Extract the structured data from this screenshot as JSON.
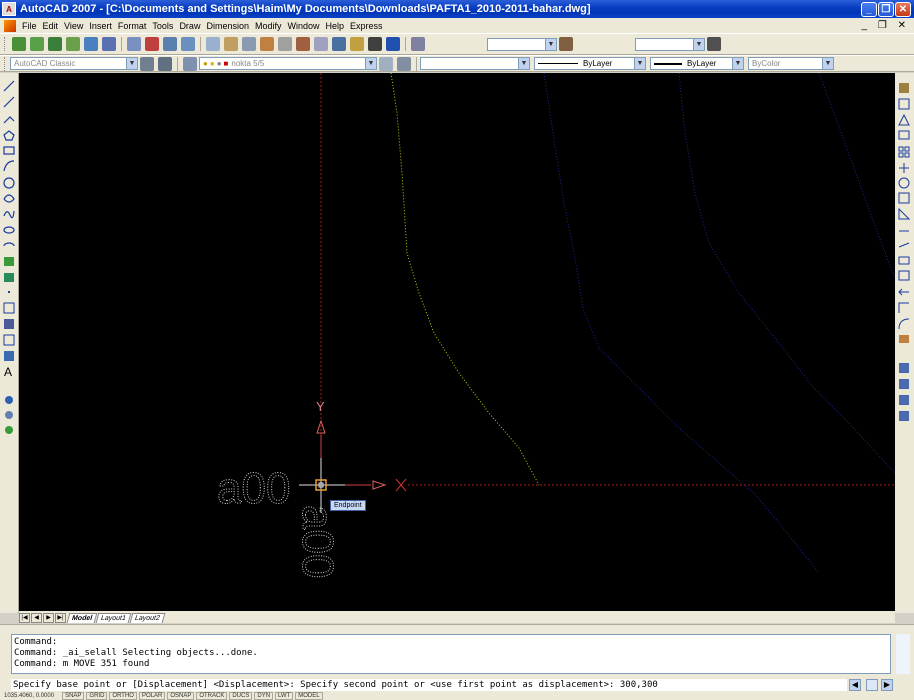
{
  "window": {
    "title": "AutoCAD 2007 - [C:\\Documents and Settings\\Haim\\My Documents\\Downloads\\PAFTA1_2010-2011-bahar.dwg]",
    "minimize": "_",
    "maximize": "❐",
    "close": "✕"
  },
  "menu": {
    "items": [
      "File",
      "Edit",
      "View",
      "Insert",
      "Format",
      "Tools",
      "Draw",
      "Dimension",
      "Modify",
      "Window",
      "Help",
      "Express"
    ],
    "doc_controls": "_ ❐ ✕"
  },
  "toolbar": {
    "workspace": "AutoCAD Classic",
    "layer": "nokta 5/5",
    "linetype": "ByLayer",
    "lineweight": "ByLayer",
    "color": "ByColor"
  },
  "canvas": {
    "y_axis_label": "Y",
    "x_axis_label": "X",
    "text_a": "a00",
    "text_b": "a00",
    "osnap_tooltip": "Endpoint"
  },
  "layout_tabs": {
    "tabs": [
      "Model",
      "Layout1",
      "Layout2"
    ],
    "active": "Model"
  },
  "command": {
    "history": [
      "Command:",
      "Command: _ai_selall Selecting objects...done.",
      "Command: m MOVE 351 found"
    ],
    "current": "Specify base point or [Displacement] <Displacement>: Specify second point or <use first point as displacement>: 300,300"
  },
  "status": {
    "coords": "1035.4060, 0.0000",
    "buttons": [
      "SNAP",
      "GRID",
      "ORTHO",
      "POLAR",
      "OSNAP",
      "OTRACK",
      "DUCS",
      "DYN",
      "LWT",
      "MODEL"
    ]
  },
  "colors": {
    "canvas_bg": "#000000",
    "titlebar": "#0a3fc2",
    "axis_red": "#b01818",
    "dotted_yellow": "#c8c800",
    "dotted_blue": "#1a2a8c"
  }
}
